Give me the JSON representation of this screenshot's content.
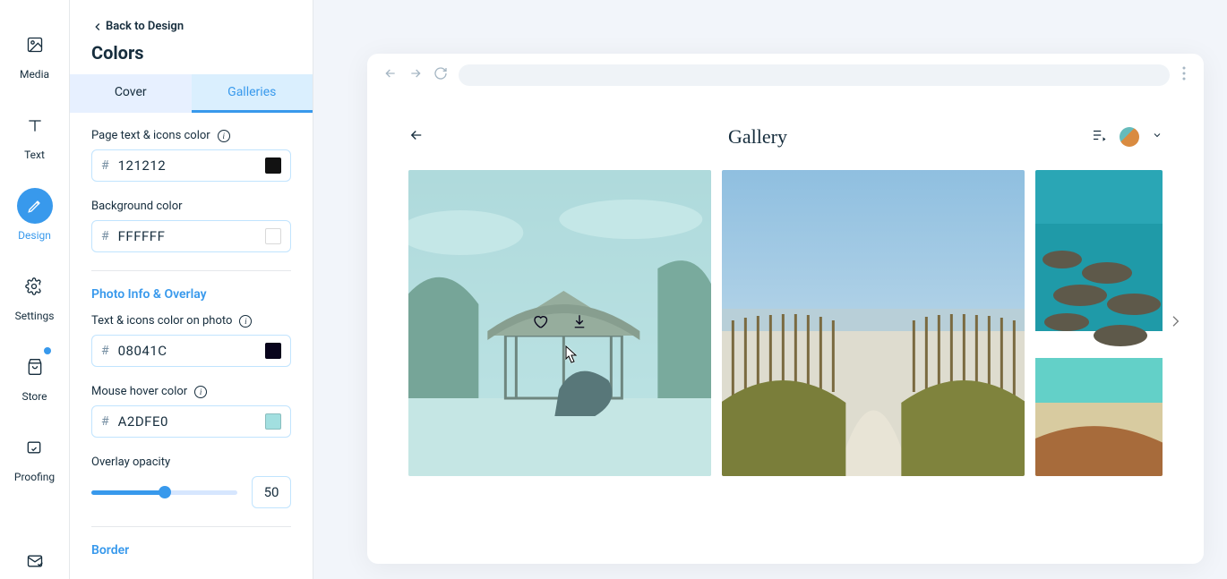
{
  "rail": {
    "items": [
      {
        "label": "Media"
      },
      {
        "label": "Text"
      },
      {
        "label": "Design"
      },
      {
        "label": "Settings"
      },
      {
        "label": "Store"
      },
      {
        "label": "Proofing"
      }
    ]
  },
  "panel": {
    "back_label": "Back to Design",
    "title": "Colors",
    "tabs": {
      "cover": "Cover",
      "galleries": "Galleries"
    },
    "page_text_label": "Page text & icons color",
    "page_text_hex": "121212",
    "page_text_swatch": "#121212",
    "bg_label": "Background color",
    "bg_hex": "FFFFFF",
    "bg_swatch": "#FFFFFF",
    "photo_info_heading": "Photo Info & Overlay",
    "text_on_photo_label": "Text & icons color on photo",
    "text_on_photo_hex": "08041C",
    "text_on_photo_swatch": "#08041C",
    "hover_label": "Mouse hover color",
    "hover_hex": "A2DFE0",
    "hover_swatch": "#A2DFE0",
    "opacity_label": "Overlay opacity",
    "opacity_value": "50",
    "border_heading": "Border"
  },
  "preview": {
    "page_title": "Gallery"
  }
}
